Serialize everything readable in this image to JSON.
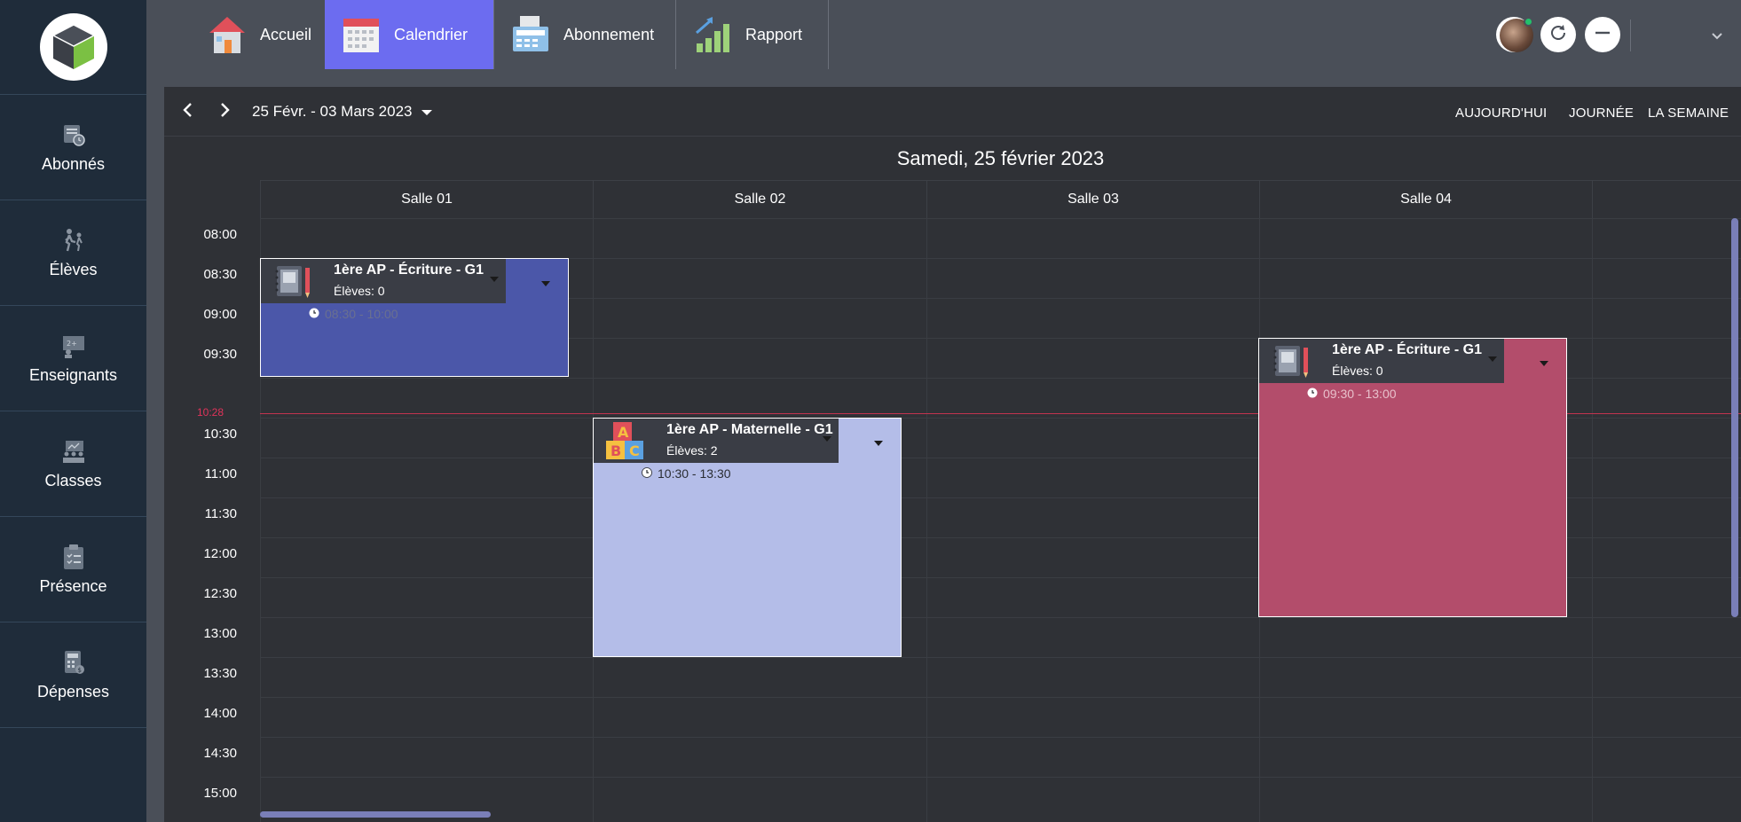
{
  "sidebar": {
    "items": [
      {
        "label": "Abonnés",
        "icon": "subscriber-card-icon"
      },
      {
        "label": "Élèves",
        "icon": "students-walking-icon"
      },
      {
        "label": "Enseignants",
        "icon": "teacher-board-icon"
      },
      {
        "label": "Classes",
        "icon": "classroom-icon"
      },
      {
        "label": "Présence",
        "icon": "attendance-clipboard-icon"
      },
      {
        "label": "Dépenses",
        "icon": "calculator-expense-icon"
      }
    ]
  },
  "topbar": {
    "tabs": [
      {
        "label": "Accueil",
        "icon": "house-icon",
        "active": false
      },
      {
        "label": "Calendrier",
        "icon": "calendar-icon",
        "active": true
      },
      {
        "label": "Abonnement",
        "icon": "cash-register-icon",
        "active": false
      },
      {
        "label": "Rapport",
        "icon": "bar-chart-icon",
        "active": false
      }
    ],
    "accent": "#6c6cf0"
  },
  "calendar": {
    "range": "25 Févr. - 03 Mars 2023",
    "views": {
      "today": "AUJOURD'HUI",
      "day": "JOURNÉE",
      "week": "LA SEMAINE"
    },
    "day_title": "Samedi, 25 février 2023",
    "rooms": [
      "Salle 01",
      "Salle 02",
      "Salle 03",
      "Salle 04"
    ],
    "times": [
      "08:00",
      "08:30",
      "09:00",
      "09:30",
      "10:30",
      "11:00",
      "11:30",
      "12:00",
      "12:30",
      "13:00",
      "13:30",
      "14:00",
      "14:30",
      "15:00"
    ],
    "now": "10:28",
    "events": [
      {
        "title": "1ère AP - Écriture - G1",
        "students": "Élèves: 0",
        "time": "08:30 - 10:00",
        "color": "#4b57a9",
        "time_color": "#6a7090",
        "icon": "notebook-pencil-icon"
      },
      {
        "title": "1ère AP - Maternelle - G1",
        "students": "Élèves: 2",
        "time": "10:30 - 13:30",
        "color": "#b4bde8",
        "time_color": "#2a2d33",
        "icon": "abc-blocks-icon"
      },
      {
        "title": "1ère AP - Écriture - G1",
        "students": "Élèves: 0",
        "time": "09:30 - 13:00",
        "color": "#b34d6b",
        "time_color": "#e8c0cb",
        "icon": "notebook-pencil-icon"
      }
    ]
  }
}
